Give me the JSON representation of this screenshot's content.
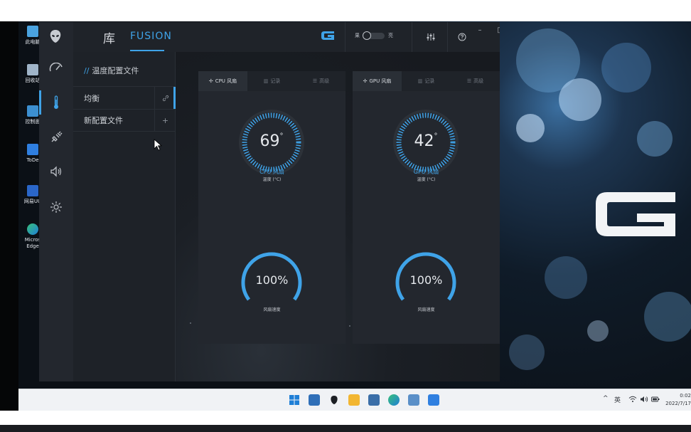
{
  "desktop": {
    "icons": [
      {
        "label": "此电脑",
        "icon": "computer-icon"
      },
      {
        "label": "回收站",
        "icon": "recycle-bin-icon"
      },
      {
        "label": "控制面",
        "icon": "control-panel-icon"
      },
      {
        "label": "ToDe",
        "icon": "todesk-icon"
      },
      {
        "label": "网易UU",
        "icon": "uu-booster-icon"
      },
      {
        "label": "Micros Edge",
        "icon": "edge-icon"
      }
    ]
  },
  "app": {
    "tabs": {
      "library": "库",
      "fusion": "FUSION"
    },
    "toggle": {
      "left_label": "果",
      "right_label": "亮"
    },
    "window_controls": {
      "minimize": "–",
      "maximize": "□",
      "close": "✕"
    },
    "sidebar": [
      "performance-icon",
      "thermometer-icon",
      "power-plug-icon",
      "speaker-icon",
      "lighting-icon"
    ],
    "profile_panel": {
      "slashes": "//",
      "title": "温度配置文件",
      "profiles": [
        {
          "name": "均衡",
          "action": "link-icon",
          "active": true
        },
        {
          "name": "新配置文件",
          "action": "+",
          "active": false
        }
      ]
    },
    "cards": [
      {
        "tabs": [
          {
            "label": "CPU 风扇",
            "icon": "fan-icon",
            "active": true
          },
          {
            "label": "记录",
            "icon": "chart-icon",
            "active": false
          },
          {
            "label": "高级",
            "icon": "sliders-icon",
            "active": false
          }
        ],
        "temperature": "69",
        "degree": "°",
        "sensor_name": "CPU 风扇",
        "temperature_label": "温度 (°C)",
        "fan_speed": "100%",
        "fan_speed_fraction": 1.0,
        "fan_speed_label": "风扇速度"
      },
      {
        "tabs": [
          {
            "label": "GPU 风扇",
            "icon": "fan-icon",
            "active": true
          },
          {
            "label": "记录",
            "icon": "chart-icon",
            "active": false
          },
          {
            "label": "高级",
            "icon": "sliders-icon",
            "active": false
          }
        ],
        "temperature": "42",
        "degree": "°",
        "sensor_name": "GPU 风扇",
        "temperature_label": "温度 (°C)",
        "fan_speed": "100%",
        "fan_speed_fraction": 1.0,
        "fan_speed_label": "风扇速度"
      }
    ],
    "accent_color": "#3fa3e8"
  },
  "taskbar": {
    "apps": [
      "windows-start-icon",
      "widgets-icon",
      "alienware-icon",
      "file-explorer-icon",
      "store-icon",
      "edge-icon",
      "settings-icon",
      "todesk-icon"
    ],
    "tray": {
      "chevron": "^",
      "ime": "英"
    },
    "clock": {
      "time": "0:02",
      "date": "2022/7/17"
    }
  }
}
